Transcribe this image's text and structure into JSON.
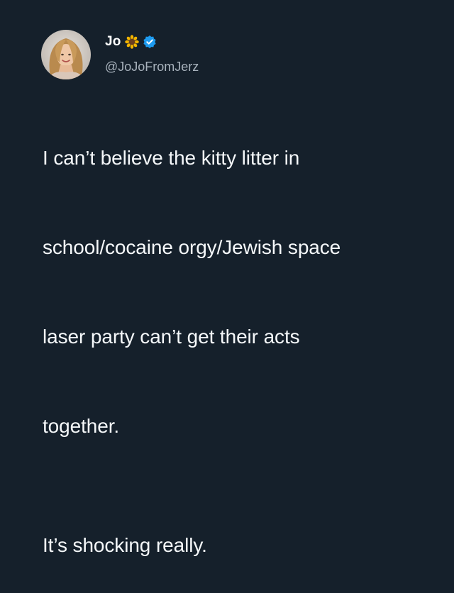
{
  "tweet": {
    "author": {
      "display_name": "Jo",
      "name_emoji": "sunflower-icon",
      "verified": true,
      "handle": "@JoJoFromJerz"
    },
    "lines": [
      "I can’t believe the kitty litter in",
      "school/cocaine orgy/Jewish space",
      "laser party can’t get their acts",
      "together."
    ],
    "closing": "It’s shocking really."
  },
  "colors": {
    "background": "#15202b",
    "text": "#f5f8fa",
    "handle": "#a9b3bd",
    "verified": "#1d9bf0",
    "sunflower_petal": "#f4b400",
    "sunflower_center": "#6b3e1f"
  }
}
